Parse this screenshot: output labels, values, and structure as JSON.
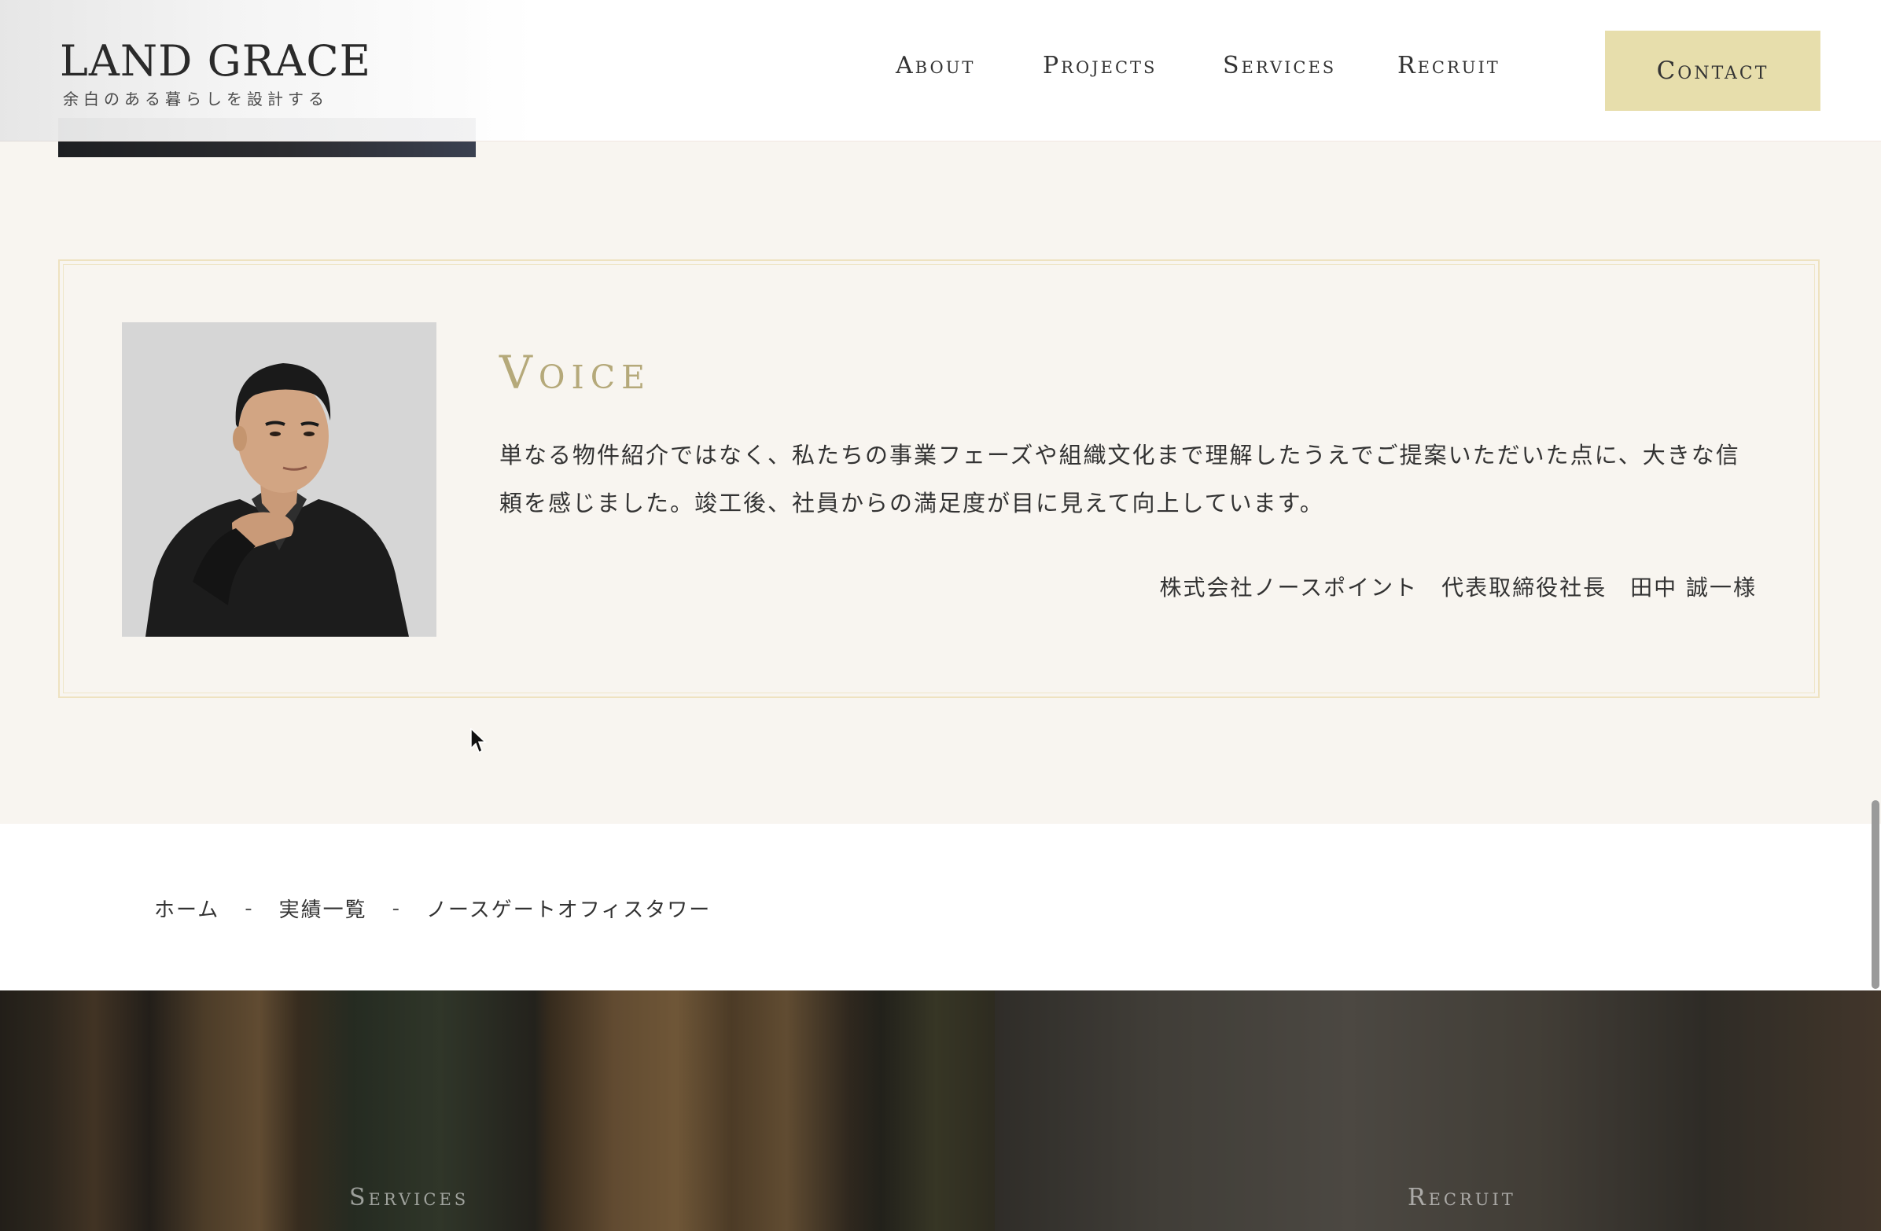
{
  "header": {
    "logo_title": "LAND GRACE",
    "logo_tagline": "余白のある暮らしを設計する",
    "nav": {
      "about": "About",
      "projects": "Projects",
      "services": "Services",
      "recruit": "Recruit"
    },
    "contact_label": "Contact"
  },
  "voice": {
    "heading": "Voice",
    "text": "単なる物件紹介ではなく、私たちの事業フェーズや組織文化まで理解したうえでご提案いただいた点に、大きな信頼を感じました。竣工後、社員からの満足度が目に見えて向上しています。",
    "author": "株式会社ノースポイント　代表取締役社長　田中 誠一様"
  },
  "breadcrumb": {
    "items": [
      "ホーム",
      "実績一覧",
      "ノースゲートオフィスタワー"
    ],
    "separator": "-"
  },
  "panels": {
    "services_label": "Services",
    "recruit_label": "Recruit"
  },
  "colors": {
    "accent_gold": "#b5a97a",
    "contact_bg": "#e7deac",
    "page_bg": "#f8f5f0",
    "card_border": "#eee2c0"
  }
}
